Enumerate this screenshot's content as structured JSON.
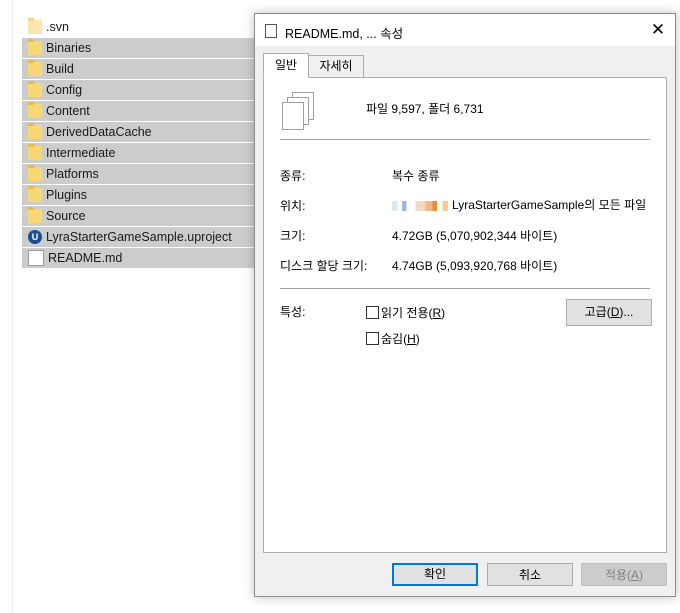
{
  "explorer": {
    "files": [
      {
        "name": ".svn",
        "type": "folder-faded",
        "selected": false
      },
      {
        "name": "Binaries",
        "type": "folder",
        "selected": true
      },
      {
        "name": "Build",
        "type": "folder",
        "selected": true
      },
      {
        "name": "Config",
        "type": "folder",
        "selected": true
      },
      {
        "name": "Content",
        "type": "folder",
        "selected": true
      },
      {
        "name": "DerivedDataCache",
        "type": "folder",
        "selected": true
      },
      {
        "name": "Intermediate",
        "type": "folder",
        "selected": true
      },
      {
        "name": "Platforms",
        "type": "folder",
        "selected": true
      },
      {
        "name": "Plugins",
        "type": "folder",
        "selected": true
      },
      {
        "name": "Source",
        "type": "folder",
        "selected": true
      },
      {
        "name": "LyraStarterGameSample.uproject",
        "type": "uproject",
        "selected": true
      },
      {
        "name": "README.md",
        "type": "document",
        "selected": true
      }
    ]
  },
  "dialog": {
    "title": "README.md, ... 속성",
    "close_glyph": "✕",
    "tabs": [
      {
        "label": "일반"
      },
      {
        "label": "자세히"
      }
    ],
    "summary": "파일 9,597, 폴더 6,731",
    "rows": {
      "type": {
        "label": "종류:",
        "value": "복수 종류"
      },
      "location": {
        "label": "위치:",
        "value": "LyraStarterGameSample의 모든 파일"
      },
      "size": {
        "label": "크기:",
        "value": "4.72GB (5,070,902,344 바이트)"
      },
      "disk_size": {
        "label": "디스크 할당 크기:",
        "value": "4.74GB (5,093,920,768 바이트)"
      }
    },
    "attributes": {
      "label": "특성:",
      "readonly": {
        "text": "읽기 전용(",
        "key": "R",
        "end": ")"
      },
      "hidden": {
        "text": "숨김(",
        "key": "H",
        "end": ")"
      },
      "advanced": {
        "text": "고급(",
        "key": "D",
        "end": ")..."
      }
    },
    "buttons": {
      "ok": "확인",
      "cancel": "취소",
      "apply": {
        "text": "적용(",
        "key": "A",
        "end": ")"
      }
    }
  }
}
